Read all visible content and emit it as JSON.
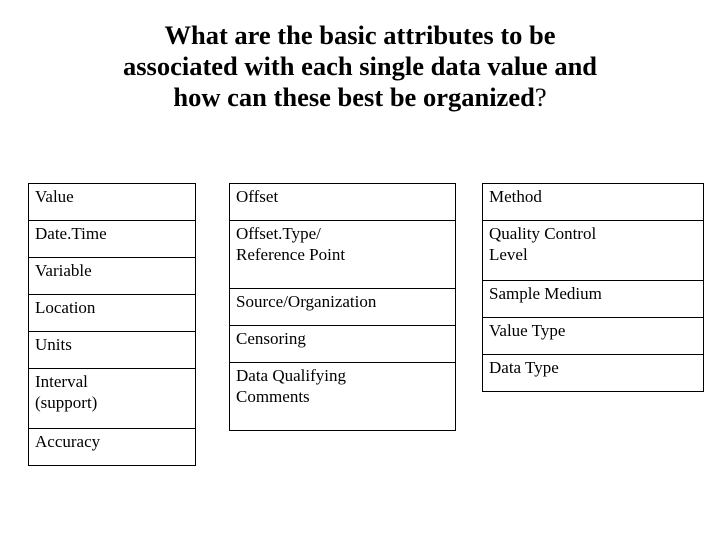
{
  "slide": {
    "title_lines": [
      "What are the basic attributes to be",
      "associated with each single data value and",
      "how can these best be organized"
    ],
    "title_terminator": "?",
    "background_color": "#ffffff",
    "text_color": "#000000",
    "border_color": "#000000"
  },
  "tables": {
    "column_1": {
      "name": "data-value-core-attributes",
      "rows": [
        {
          "label": "Value",
          "multiline": false
        },
        {
          "label": "Date.Time",
          "multiline": false
        },
        {
          "label": "Variable",
          "multiline": false
        },
        {
          "label": "Location",
          "multiline": false
        },
        {
          "label": "Units",
          "multiline": false
        },
        {
          "label": "Interval\n(support)",
          "multiline": true
        },
        {
          "label": "Accuracy",
          "multiline": false
        }
      ]
    },
    "column_2": {
      "name": "data-value-context-attributes",
      "rows": [
        {
          "label": "Offset",
          "multiline": false
        },
        {
          "label": "Offset.Type/\nReference Point",
          "multiline": true
        },
        {
          "label": "Source/Organization",
          "multiline": false
        },
        {
          "label": "Censoring",
          "multiline": false
        },
        {
          "label": "Data Qualifying\nComments",
          "multiline": true
        }
      ]
    },
    "column_3": {
      "name": "data-value-quality-attributes",
      "rows": [
        {
          "label": "Method",
          "multiline": false
        },
        {
          "label": "Quality Control\nLevel",
          "multiline": true
        },
        {
          "label": "Sample Medium",
          "multiline": false
        },
        {
          "label": "Value Type",
          "multiline": false
        },
        {
          "label": "Data Type",
          "multiline": false
        }
      ]
    }
  }
}
